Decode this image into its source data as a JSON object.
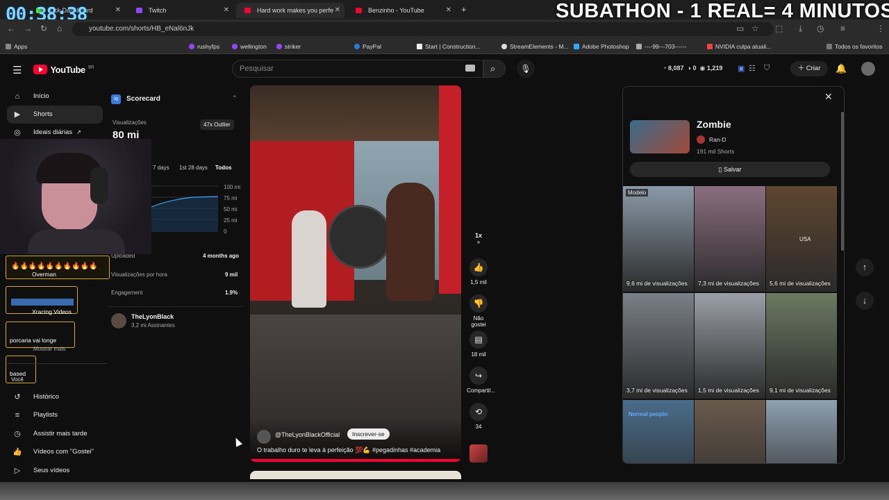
{
  "overlay": {
    "timer": "00:38:38",
    "subathon": "SUBATHON - 1 REAL= 4 MINUTOS"
  },
  "browser": {
    "tabs": [
      {
        "title": "Kick Dashboard"
      },
      {
        "title": "Twitch"
      },
      {
        "title": "Hard work makes you perfe"
      },
      {
        "title": "Benzinho - YouTube"
      }
    ],
    "url": "youtube.com/shorts/HB_eNal6nJk",
    "bookmarks": [
      "Apps",
      "rushyfps",
      "wellington",
      "striker",
      "PayPal",
      "Start | Construction...",
      "StreamElements - M...",
      "Adobe Photoshop",
      "----99---703------",
      "NVIDIA culpa atuali...",
      "Todos os favoritos"
    ]
  },
  "yt": {
    "logo": "YouTube",
    "region": "BR",
    "search_placeholder": "Pesquisar",
    "stats": [
      "8,087",
      "0",
      "1,219"
    ],
    "create": "Criar"
  },
  "sidebar": {
    "top": [
      {
        "label": "Início",
        "icon": "home-icon"
      },
      {
        "label": "Shorts",
        "icon": "shorts-icon"
      },
      {
        "label": "Ideais diárias",
        "icon": "ideas-icon"
      }
    ],
    "bottom": [
      {
        "label": "Histórico",
        "icon": "history-icon"
      },
      {
        "label": "Playlists",
        "icon": "playlists-icon"
      },
      {
        "label": "Assistir mais tarde",
        "icon": "watch-later-icon"
      },
      {
        "label": "Vídeos com \"Gostei\"",
        "icon": "like-icon"
      },
      {
        "label": "Seus vídeos",
        "icon": "your-videos-icon"
      }
    ]
  },
  "scorecard": {
    "title": "Scorecard",
    "views_label": "Visualizações",
    "views": "80 mi",
    "outlier": "47x Outlier",
    "ranges": [
      "7 days",
      "1st 28 days",
      "Todos"
    ],
    "y_ticks": [
      "100 mi",
      "75 mi",
      "50 mi",
      "25 mi",
      "0"
    ],
    "rows": [
      {
        "label": "Uploaded",
        "value": "4 months ago"
      },
      {
        "label": "Visualizações por hora",
        "value": "9 mil"
      },
      {
        "label": "Engagement",
        "value": "1.9%"
      }
    ],
    "channel": {
      "name": "TheLyonBlack",
      "subs": "3,2 mi Assinantes"
    }
  },
  "chat": [
    {
      "user": "Overman"
    },
    {
      "user": "Xracing Videos"
    },
    {
      "user": "porcaria vai longe"
    },
    {
      "user": "based"
    }
  ],
  "chat_extra": {
    "show_more": "Mostrar mais",
    "you": "Você"
  },
  "video": {
    "channel": "@TheLyonBlackOfficial",
    "subscribe": "Inscrever-se",
    "caption": "O trabalho duro te leva à perfeição 💯💪 #pegadinhas #academia",
    "actions": [
      {
        "label": "1x",
        "icon": "speed-icon"
      },
      {
        "label": "1,5 mil",
        "icon": "like-icon"
      },
      {
        "label": "Não gostei",
        "icon": "dislike-icon"
      },
      {
        "label": "18 mil",
        "icon": "comment-icon"
      },
      {
        "label": "Compartil...",
        "icon": "share-icon"
      },
      {
        "label": "34",
        "icon": "remix-icon"
      }
    ]
  },
  "panel": {
    "title": "Zombie",
    "artist": "Ran-D",
    "count": "191 mil Shorts",
    "save": "Salvar",
    "thumbs": [
      {
        "label": "9,6 mi de visualizações",
        "badge": "Modelo",
        "color": "#8a9aa8"
      },
      {
        "label": "7,3 mi de visualizações",
        "badge": "",
        "color": "#8a6e7e"
      },
      {
        "label": "5,6 mi de visualizações",
        "badge": "USA",
        "color": "#5f4630"
      },
      {
        "label": "3,7 mi de visualizações",
        "badge": "",
        "color": "#7a8088"
      },
      {
        "label": "1,5 mi de visualizações",
        "badge": "",
        "color": "#9aa0a6"
      },
      {
        "label": "9,1 mi de visualizações",
        "badge": "",
        "color": "#6b7a62"
      },
      {
        "label": "",
        "badge": "Normal people:",
        "color": "#4a6c8a"
      },
      {
        "label": "",
        "badge": "",
        "color": "#6a5a4c"
      },
      {
        "label": "",
        "badge": "",
        "color": "#8ea0b0"
      }
    ]
  }
}
